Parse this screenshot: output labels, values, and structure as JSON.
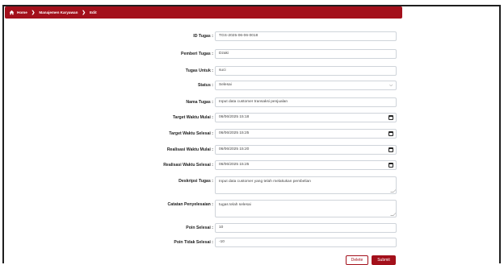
{
  "breadcrumb": {
    "home": "Home",
    "section": "Manajemen Karyawan",
    "current": "Edit"
  },
  "form": {
    "id_tugas": {
      "label": "ID Tugas :",
      "value": "TGS-2025-06-06-0018"
    },
    "pemberi_tugas": {
      "label": "Pemberi Tugas :",
      "value": "Dzaki"
    },
    "tugas_untuk": {
      "label": "Tugas Untuk :",
      "value": "suci"
    },
    "status": {
      "label": "Status :",
      "value": "Selesai"
    },
    "nama_tugas": {
      "label": "Nama Tugas :",
      "value": "Input data customer transaksi penjualan"
    },
    "target_mulai": {
      "label": "Target Waktu Mulai :",
      "value": "06/06/2025 15:18"
    },
    "target_selesai": {
      "label": "Target Waktu Selesai :",
      "value": "06/06/2025 15:25"
    },
    "realisasi_mulai": {
      "label": "Realisasi Waktu Mulai :",
      "value": "06/06/2025 15:20"
    },
    "realisasi_selesai": {
      "label": "Realisasi Waktu Selesai :",
      "value": "06/06/2025 15:25"
    },
    "deskripsi": {
      "label": "Deskripsi Tugas :",
      "value": "Input data customer yang telah melakukan pembelian"
    },
    "catatan": {
      "label": "Catatan Penyelesaian :",
      "value": "tugas telah selesai"
    },
    "poin_selesai": {
      "label": "Poin Selesai :",
      "value": "10"
    },
    "poin_tidak_selesai": {
      "label": "Poin Tidak Selesai :",
      "value": "-10"
    }
  },
  "actions": {
    "delete_label": "Delete",
    "submit_label": "Submit"
  },
  "colors": {
    "primary": "#a3101b",
    "border": "#cfd4da"
  }
}
